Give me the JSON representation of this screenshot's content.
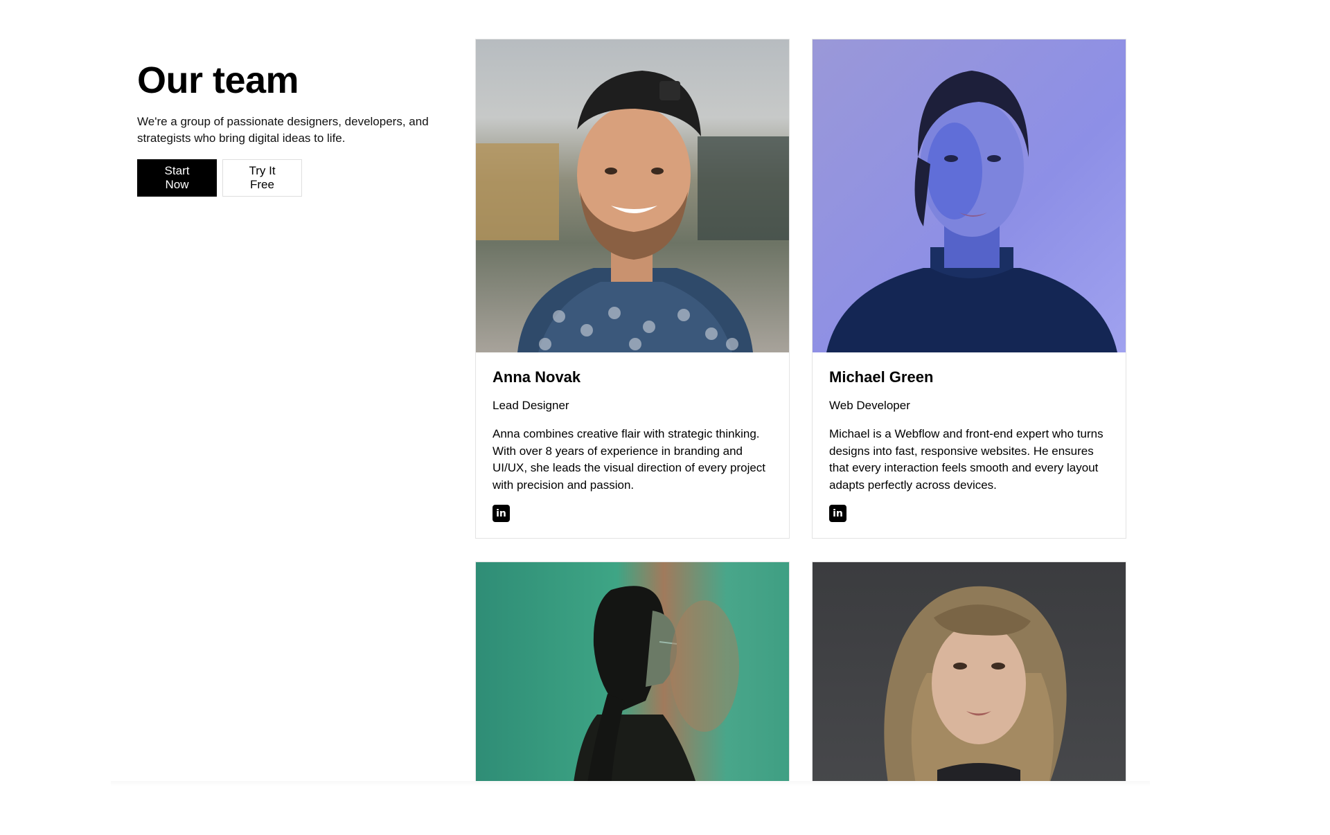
{
  "intro": {
    "title": "Our team",
    "description": "We're a group of passionate designers, developers, and strategists who bring digital ideas to life.",
    "primary_button": "Start Now",
    "secondary_button": "Try It Free"
  },
  "members": [
    {
      "name": "Anna Novak",
      "role": "Lead Designer",
      "bio": "Anna combines creative flair with strategic thinking. With over 8 years of experience in branding and UI/UX, she leads the visual direction of every project with precision and passion.",
      "social_icon": "linkedin-icon"
    },
    {
      "name": "Michael Green",
      "role": "Web Developer",
      "bio": "Michael is a Webflow and front-end expert who turns designs into fast, responsive websites. He ensures that every interaction feels smooth and every layout adapts perfectly across devices.",
      "social_icon": "linkedin-icon"
    },
    {
      "photo": "portrait-woman-green-background"
    },
    {
      "photo": "portrait-woman-gray-background"
    }
  ],
  "colors": {
    "primary_button_bg": "#000000",
    "card_border": "#e3e3e3"
  }
}
